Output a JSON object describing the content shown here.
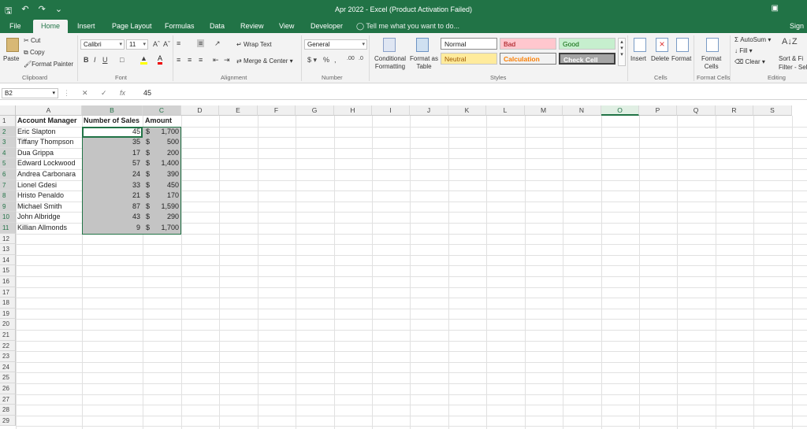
{
  "window": {
    "title": "Apr 2022 - Excel (Product Activation Failed)",
    "sign_in": "Sign"
  },
  "tabs": [
    "File",
    "Home",
    "Insert",
    "Page Layout",
    "Formulas",
    "Data",
    "Review",
    "View",
    "Developer"
  ],
  "tell_me": "Tell me what you want to do...",
  "ribbon": {
    "clipboard": {
      "paste": "Paste",
      "cut": "Cut",
      "copy": "Copy",
      "format_painter": "Format Painter",
      "label": "Clipboard"
    },
    "font": {
      "name": "Calibri",
      "size": "11",
      "label": "Font"
    },
    "alignment": {
      "wrap_text": "Wrap Text",
      "merge_center": "Merge & Center",
      "label": "Alignment"
    },
    "number": {
      "format": "General",
      "label": "Number"
    },
    "styles": {
      "conditional": "Conditional Formatting",
      "format_as_table": "Format as Table",
      "normal": "Normal",
      "bad": "Bad",
      "good": "Good",
      "neutral": "Neutral",
      "calculation": "Calculation",
      "check_cell": "Check Cell",
      "label": "Styles"
    },
    "cells": {
      "insert": "Insert",
      "delete": "Delete",
      "format": "Format",
      "label": "Cells"
    },
    "format_cells": {
      "format": "Format",
      "cells": "Cells",
      "label": "Format Cells"
    },
    "editing": {
      "autosum": "AutoSum",
      "fill": "Fill",
      "clear": "Clear",
      "sort": "Sort & Fi",
      "filter": "Filter - Sel",
      "label": "Editing"
    }
  },
  "formula_bar": {
    "name_box": "B2",
    "fx": "fx",
    "value": "45"
  },
  "columns": [
    "A",
    "B",
    "C",
    "D",
    "E",
    "F",
    "G",
    "H",
    "I",
    "J",
    "K",
    "L",
    "M",
    "N",
    "O",
    "P",
    "Q",
    "R",
    "S"
  ],
  "headers": {
    "a": "Account Manager",
    "b": "Number of Sales",
    "c": "Amount"
  },
  "rows": [
    {
      "name": "Eric Slapton",
      "sales": "45",
      "cur": "$",
      "amount": "1,700"
    },
    {
      "name": "Tiffany Thompson",
      "sales": "35",
      "cur": "$",
      "amount": "500"
    },
    {
      "name": "Dua Grippa",
      "sales": "17",
      "cur": "$",
      "amount": "200"
    },
    {
      "name": "Edward Lockwood",
      "sales": "57",
      "cur": "$",
      "amount": "1,400"
    },
    {
      "name": "Andrea Carbonara",
      "sales": "24",
      "cur": "$",
      "amount": "390"
    },
    {
      "name": "Lionel Gdesi",
      "sales": "33",
      "cur": "$",
      "amount": "450"
    },
    {
      "name": "Hristo Penaldo",
      "sales": "21",
      "cur": "$",
      "amount": "170"
    },
    {
      "name": "Michael Smith",
      "sales": "87",
      "cur": "$",
      "amount": "1,590"
    },
    {
      "name": "John Albridge",
      "sales": "43",
      "cur": "$",
      "amount": "290"
    },
    {
      "name": "Killian Allmonds",
      "sales": "9",
      "cur": "$",
      "amount": "1,700"
    }
  ],
  "row_numbers": [
    "1",
    "2",
    "3",
    "4",
    "5",
    "6",
    "7",
    "8",
    "9",
    "10",
    "11",
    "12",
    "13",
    "14",
    "15",
    "16",
    "17",
    "18",
    "19",
    "20",
    "21",
    "22",
    "23",
    "24",
    "25",
    "26",
    "27",
    "28",
    "29"
  ],
  "colors": {
    "brand": "#217346",
    "bad_bg": "#ffc7ce",
    "good_bg": "#c6efce",
    "neutral_bg": "#ffeb9c",
    "check_bg": "#a5a5a5"
  }
}
